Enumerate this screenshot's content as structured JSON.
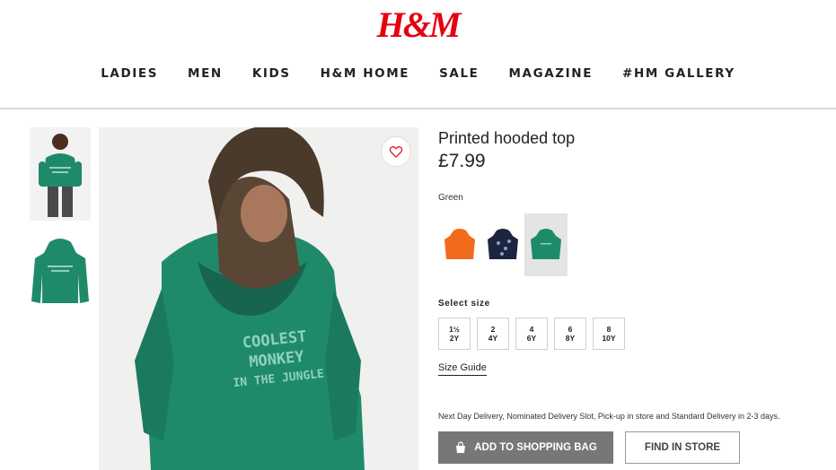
{
  "brand": {
    "logo_text": "H&M",
    "logo_color": "#e50010"
  },
  "nav": {
    "items": [
      "LADIES",
      "MEN",
      "KIDS",
      "H&M HOME",
      "SALE",
      "MAGAZINE",
      "#HM GALLERY"
    ]
  },
  "product": {
    "name": "Printed hooded top",
    "price": "£7.99",
    "print_line1": "COOLEST MONKEY",
    "print_line2": "IN THE JUNGLE",
    "hoodie_color": "#1f8a6a"
  },
  "color": {
    "selected_label": "Green",
    "swatches": [
      "orange-hoodie",
      "navy-print-hoodie",
      "green-hoodie"
    ]
  },
  "size": {
    "label": "Select size",
    "options": [
      {
        "top": "1½",
        "bottom": "2Y"
      },
      {
        "top": "2",
        "bottom": "4Y"
      },
      {
        "top": "4",
        "bottom": "6Y"
      },
      {
        "top": "6",
        "bottom": "8Y"
      },
      {
        "top": "8",
        "bottom": "10Y"
      }
    ],
    "guide_label": "Size Guide"
  },
  "delivery_text": "Next Day Delivery, Nominated Delivery Slot, Pick-up in store and Standard Delivery in 2-3 days.",
  "actions": {
    "add_to_bag": "ADD TO SHOPPING BAG",
    "find_in_store": "FIND IN STORE"
  },
  "icons": {
    "favourite": "heart-icon",
    "bag": "shopping-bag-icon"
  }
}
